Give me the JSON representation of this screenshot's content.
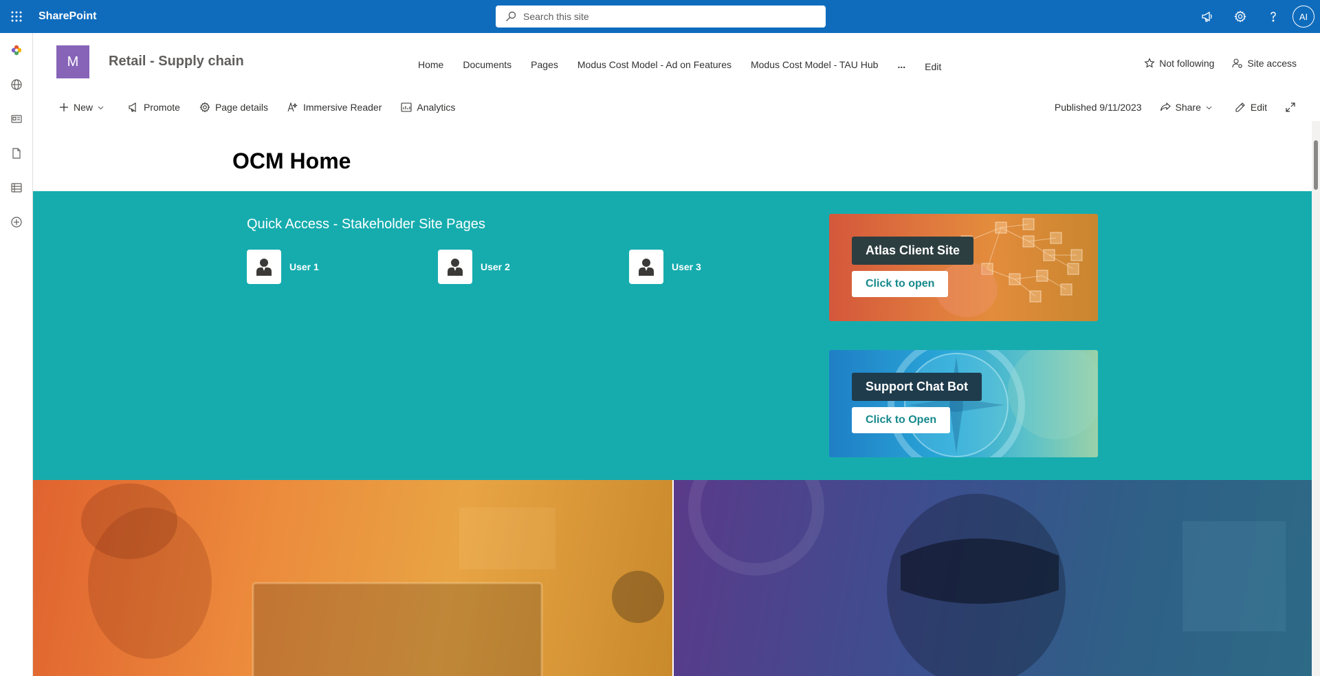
{
  "suite": {
    "brand": "SharePoint",
    "search_placeholder": "Search this site",
    "avatar_initials": "AI"
  },
  "site": {
    "logo_letter": "M",
    "title": "Retail - Supply chain",
    "nav": [
      "Home",
      "Documents",
      "Pages",
      "Modus Cost Model - Ad on Features",
      "Modus Cost Model - TAU Hub"
    ],
    "nav_more": "...",
    "nav_edit": "Edit",
    "follow_label": "Not following",
    "site_access_label": "Site access"
  },
  "commandbar": {
    "new_label": "New",
    "promote_label": "Promote",
    "page_details_label": "Page details",
    "immersive_reader_label": "Immersive Reader",
    "analytics_label": "Analytics",
    "published_label": "Published 9/11/2023",
    "share_label": "Share",
    "edit_label": "Edit"
  },
  "page": {
    "title": "OCM Home"
  },
  "quick_access": {
    "title": "Quick Access - Stakeholder Site Pages",
    "people": [
      "User 1",
      "User 2",
      "User 3"
    ]
  },
  "tiles": {
    "atlas": {
      "label": "Atlas Client Site",
      "button": "Click to open"
    },
    "chat": {
      "label": "Support Chat Bot",
      "button": "Click to Open"
    }
  },
  "colors": {
    "suite_blue": "#0f6cbd",
    "teal": "#16acae",
    "site_logo": "#8764b8"
  }
}
